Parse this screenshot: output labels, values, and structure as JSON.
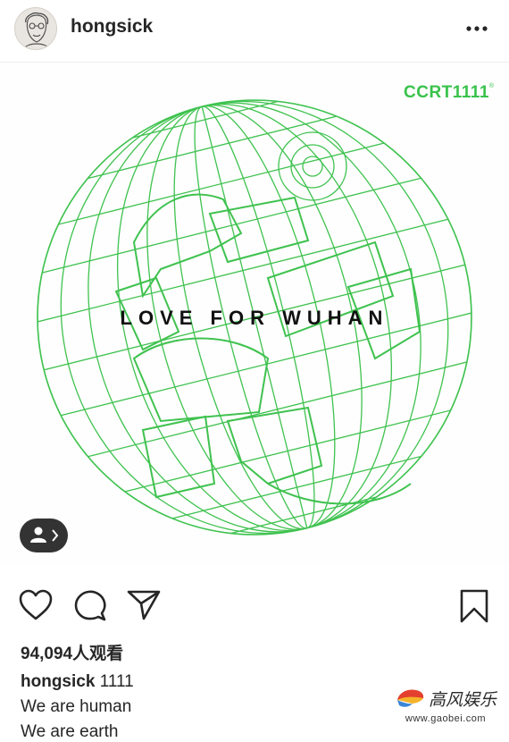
{
  "header": {
    "username": "hongsick",
    "avatar_icon": "sketch-face-avatar",
    "more_icon": "more-horizontal-icon"
  },
  "post_image": {
    "brand": "CCRT1111",
    "brand_mark": "®",
    "headline": "LOVE FOR WUHAN",
    "accent_color": "#39c24c",
    "graphic": "green wireframe globe with chinese characters"
  },
  "tag_button": {
    "icon": "person-tag-icon",
    "chevron": "chevron-right-icon"
  },
  "actions": {
    "like_icon": "heart-icon",
    "comment_icon": "comment-icon",
    "share_icon": "send-icon",
    "save_icon": "bookmark-icon"
  },
  "stats": {
    "views": "94,094人观看"
  },
  "caption": {
    "username": "hongsick",
    "text": "1111",
    "lines": [
      "We are human",
      "We are earth"
    ]
  },
  "watermark": {
    "title": "高风娱乐",
    "url": "www.gaobei.com"
  }
}
